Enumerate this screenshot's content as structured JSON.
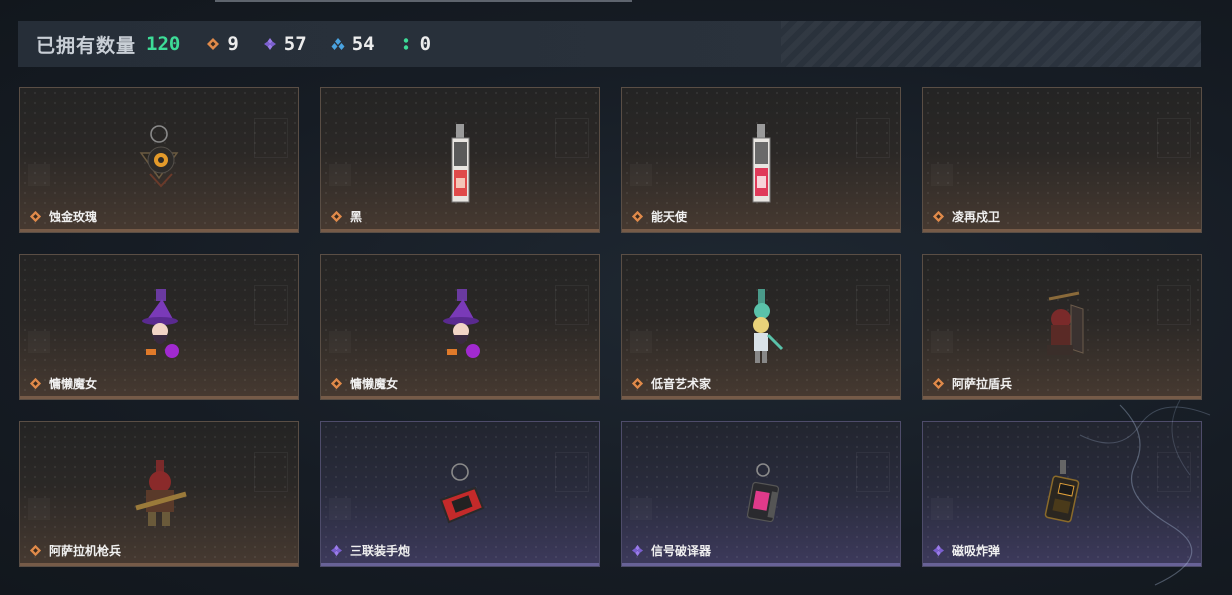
{
  "header": {
    "owned_label": "已拥有数量",
    "owned_count": "120",
    "stats": [
      {
        "rarity": "orange-diamond-icon",
        "color": "#e08a4a",
        "value": "9"
      },
      {
        "rarity": "purple-diamond-icon",
        "color": "#9a7bea",
        "value": "57"
      },
      {
        "rarity": "blue-triple-icon",
        "color": "#4aa3e0",
        "value": "54"
      },
      {
        "rarity": "green-dots-icon",
        "color": "#3ddc97",
        "value": "0"
      }
    ]
  },
  "colors": {
    "accent_green": "#3ddc97",
    "orange_rarity": "#e08a4a",
    "purple_rarity": "#9a7bea"
  },
  "items": [
    {
      "name": "蚀金玫瑰",
      "rarity": "orange",
      "art": "rose-charm"
    },
    {
      "name": "黑",
      "rarity": "orange",
      "art": "card-charm"
    },
    {
      "name": "能天使",
      "rarity": "orange",
      "art": "card-charm"
    },
    {
      "name": "凌再戍卫",
      "rarity": "orange",
      "art": "none"
    },
    {
      "name": "慵懒魔女",
      "rarity": "orange",
      "art": "witch-charm"
    },
    {
      "name": "慵懒魔女",
      "rarity": "orange",
      "art": "witch-charm"
    },
    {
      "name": "低音艺术家",
      "rarity": "orange",
      "art": "bass-artist-charm"
    },
    {
      "name": "阿萨拉盾兵",
      "rarity": "orange",
      "art": "shield-soldier-charm"
    },
    {
      "name": "阿萨拉机枪兵",
      "rarity": "orange",
      "art": "gunner-charm"
    },
    {
      "name": "三联装手炮",
      "rarity": "purple",
      "art": "hand-cannon-charm"
    },
    {
      "name": "信号破译器",
      "rarity": "purple",
      "art": "decoder-charm"
    },
    {
      "name": "磁吸炸弹",
      "rarity": "purple",
      "art": "magnet-bomb-charm"
    }
  ]
}
